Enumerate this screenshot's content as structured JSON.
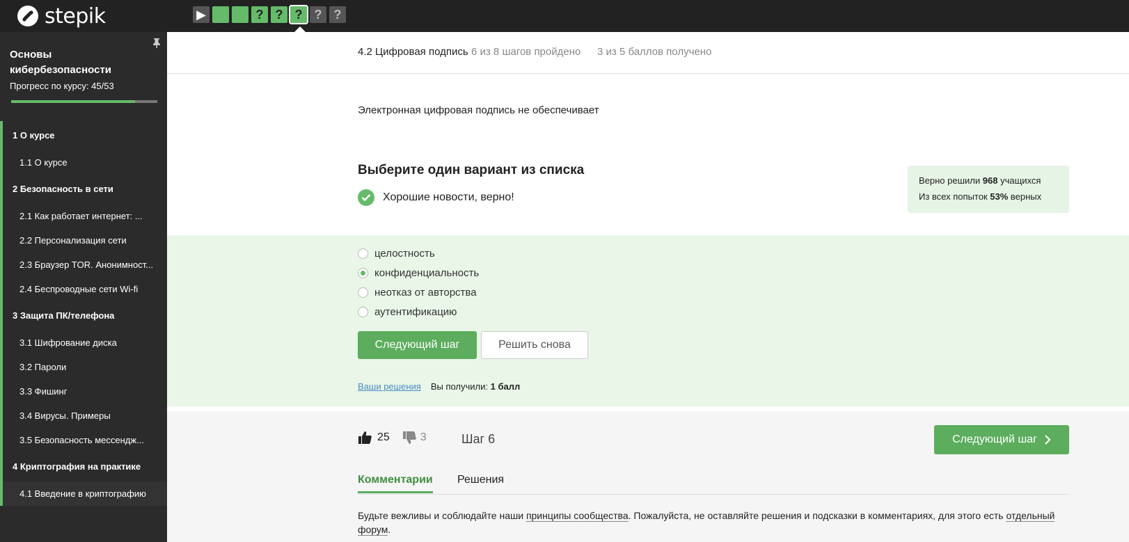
{
  "app": {
    "logo_text": "stepik"
  },
  "step_nav": [
    {
      "kind": "intro",
      "label": "▶"
    },
    {
      "kind": "done",
      "label": ""
    },
    {
      "kind": "done",
      "label": ""
    },
    {
      "kind": "q-green",
      "label": "?"
    },
    {
      "kind": "q-green",
      "label": "?"
    },
    {
      "kind": "q-green current",
      "label": "?"
    },
    {
      "kind": "q-grey",
      "label": "?"
    },
    {
      "kind": "q-grey",
      "label": "?"
    }
  ],
  "sidebar": {
    "course_title": "Основы кибербезопасности",
    "progress_label": "Прогресс по курсу:  45/53",
    "progress_fraction": 0.849,
    "items": [
      {
        "type": "section",
        "label": "1  О курсе"
      },
      {
        "type": "lesson",
        "label": "1.1  О курсе"
      },
      {
        "type": "section",
        "label": "2  Безопасность в сети"
      },
      {
        "type": "lesson",
        "label": "2.1  Как работает интернет: ..."
      },
      {
        "type": "lesson",
        "label": "2.2  Персонализация сети"
      },
      {
        "type": "lesson",
        "label": "2.3  Браузер TOR. Анонимност..."
      },
      {
        "type": "lesson",
        "label": "2.4  Беспроводные сети Wi-fi"
      },
      {
        "type": "section",
        "label": "3  Защита ПК/телефона"
      },
      {
        "type": "lesson",
        "label": "3.1  Шифрование диска"
      },
      {
        "type": "lesson",
        "label": "3.2  Пароли"
      },
      {
        "type": "lesson",
        "label": "3.3  Фишинг"
      },
      {
        "type": "lesson",
        "label": "3.4  Вирусы. Примеры"
      },
      {
        "type": "lesson",
        "label": "3.5  Безопасность мессендж..."
      },
      {
        "type": "section",
        "label": "4  Криптография на практике"
      },
      {
        "type": "lesson",
        "label": "4.1  Введение в криптографию"
      }
    ]
  },
  "header": {
    "lesson_title": "4.2 Цифровая подпись",
    "steps_passed": "6 из 8 шагов пройдено",
    "points": "3 из 5 баллов  получено"
  },
  "quiz": {
    "question": "Электронная цифровая подпись не обеспечивает",
    "instruction": "Выберите один вариант из списка",
    "feedback": "Хорошие новости, верно!",
    "stats": {
      "solved_prefix": "Верно решили ",
      "solved_count": "968",
      "solved_suffix": " учащихся",
      "attempts_prefix": "Из всех попыток ",
      "attempts_pct": "53%",
      "attempts_suffix": " верных"
    },
    "options": [
      {
        "label": "целостность",
        "checked": false
      },
      {
        "label": "конфиденциальность",
        "checked": true
      },
      {
        "label": "неотказ от авторства",
        "checked": false
      },
      {
        "label": "аутентификацию",
        "checked": false
      }
    ],
    "next_label": "Следующий шаг",
    "retry_label": "Решить снова",
    "your_solutions": "Ваши решения",
    "score_prefix": "Вы получили: ",
    "score_value": "1 балл"
  },
  "footer": {
    "likes": "25",
    "dislikes": "3",
    "step_label": "Шаг 6",
    "next_label": "Следующий шаг",
    "tabs": [
      "Комментарии",
      "Решения"
    ],
    "rules_1": "Будьте вежливы и соблюдайте наши ",
    "rules_link_1": "принципы сообщества",
    "rules_2": ". Пожалуйста, не оставляйте решения и подсказки в комментариях, для этого есть ",
    "rules_link_2": "отдельный форум",
    "rules_3": "."
  },
  "colors": {
    "accent": "#66bb6a",
    "button": "#5cad5d",
    "answer_bg": "#e9f6e8",
    "topbar": "#222222"
  }
}
